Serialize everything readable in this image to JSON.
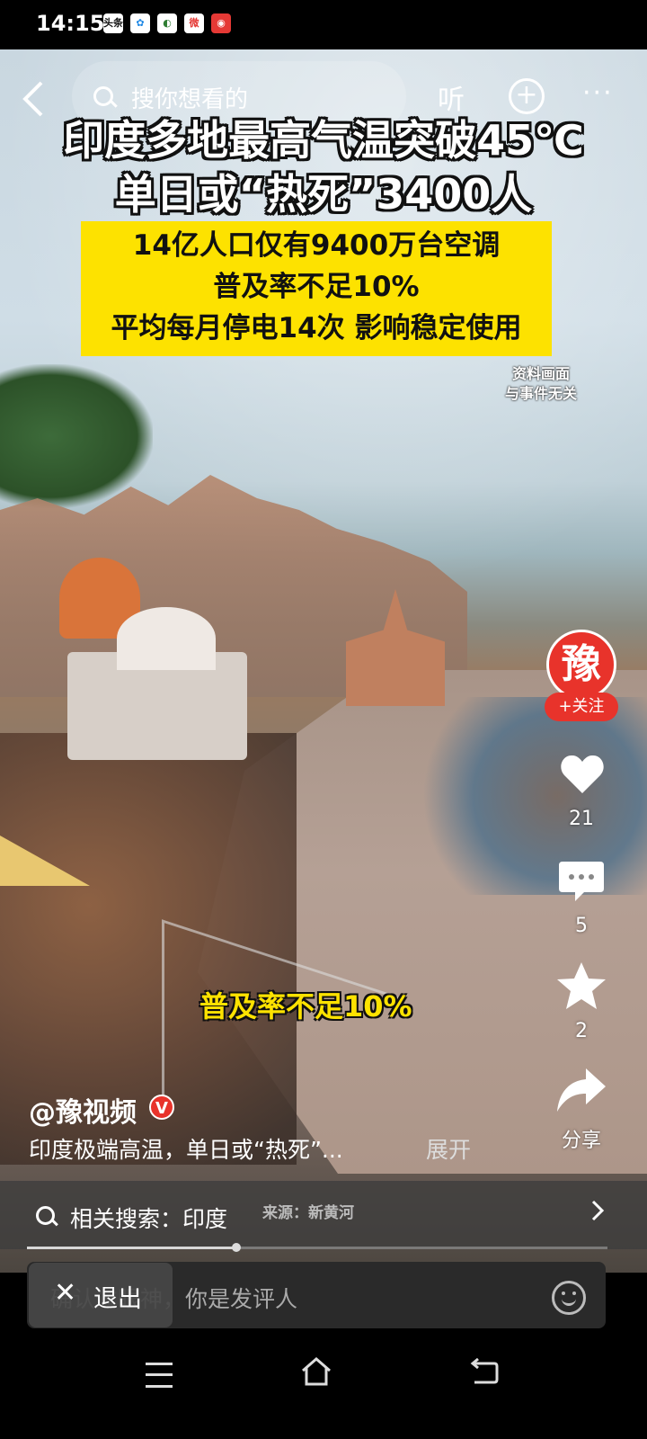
{
  "status_bar": {
    "time": "14:15",
    "icons": [
      {
        "name": "toutiao-icon",
        "label": "头条",
        "color": "#ffffff",
        "text": "#111111"
      },
      {
        "name": "app-icon",
        "label": "✿",
        "color": "#ffffff",
        "text": "#1e88e5"
      },
      {
        "name": "mobile-app-icon",
        "label": "◐",
        "color": "#ffffff",
        "text": "#2e7d32"
      },
      {
        "name": "weibo-icon",
        "label": "微",
        "color": "#ffffff",
        "text": "#e53935"
      },
      {
        "name": "news-app-icon",
        "label": "◉",
        "color": "#e53935",
        "text": "#ffffff"
      }
    ]
  },
  "top_bar": {
    "back_icon": "chevron-left-icon",
    "search_placeholder": "搜你想看的",
    "listen_label": "听",
    "add_icon": "plus-circle-icon",
    "more_label": "···"
  },
  "video": {
    "headline_line1": "印度多地最高气温突破45℃",
    "headline_line2": "单日或“热死”3400人",
    "box_line1": "14亿人口仅有9400万台空调",
    "box_line2": "普及率不足10%",
    "box_line3": "平均每月停电14次 影响稳定使用",
    "disclaimer_line1": "资料画面",
    "disclaimer_line2": "与事件无关",
    "subtitle": "普及率不足10%"
  },
  "side_rail": {
    "avatar_label": "豫",
    "follow_label": "+关注",
    "likes": "21",
    "comments": "5",
    "favorites": "2",
    "share_label": "分享"
  },
  "post": {
    "author": "@豫视频",
    "verified_label": "V",
    "caption": "印度极端高温，单日或“热死”...",
    "expand_label": "展开"
  },
  "related": {
    "label": "相关搜索：印度",
    "source": "来源：新黄河"
  },
  "progress": 0.36,
  "comment_bar": {
    "placeholder": "确认过眼神，你是发评人",
    "exit_label": "退出",
    "close_label": "✕"
  },
  "colors": {
    "accent_red": "#e8332b",
    "highlight_yellow": "#fde200"
  }
}
